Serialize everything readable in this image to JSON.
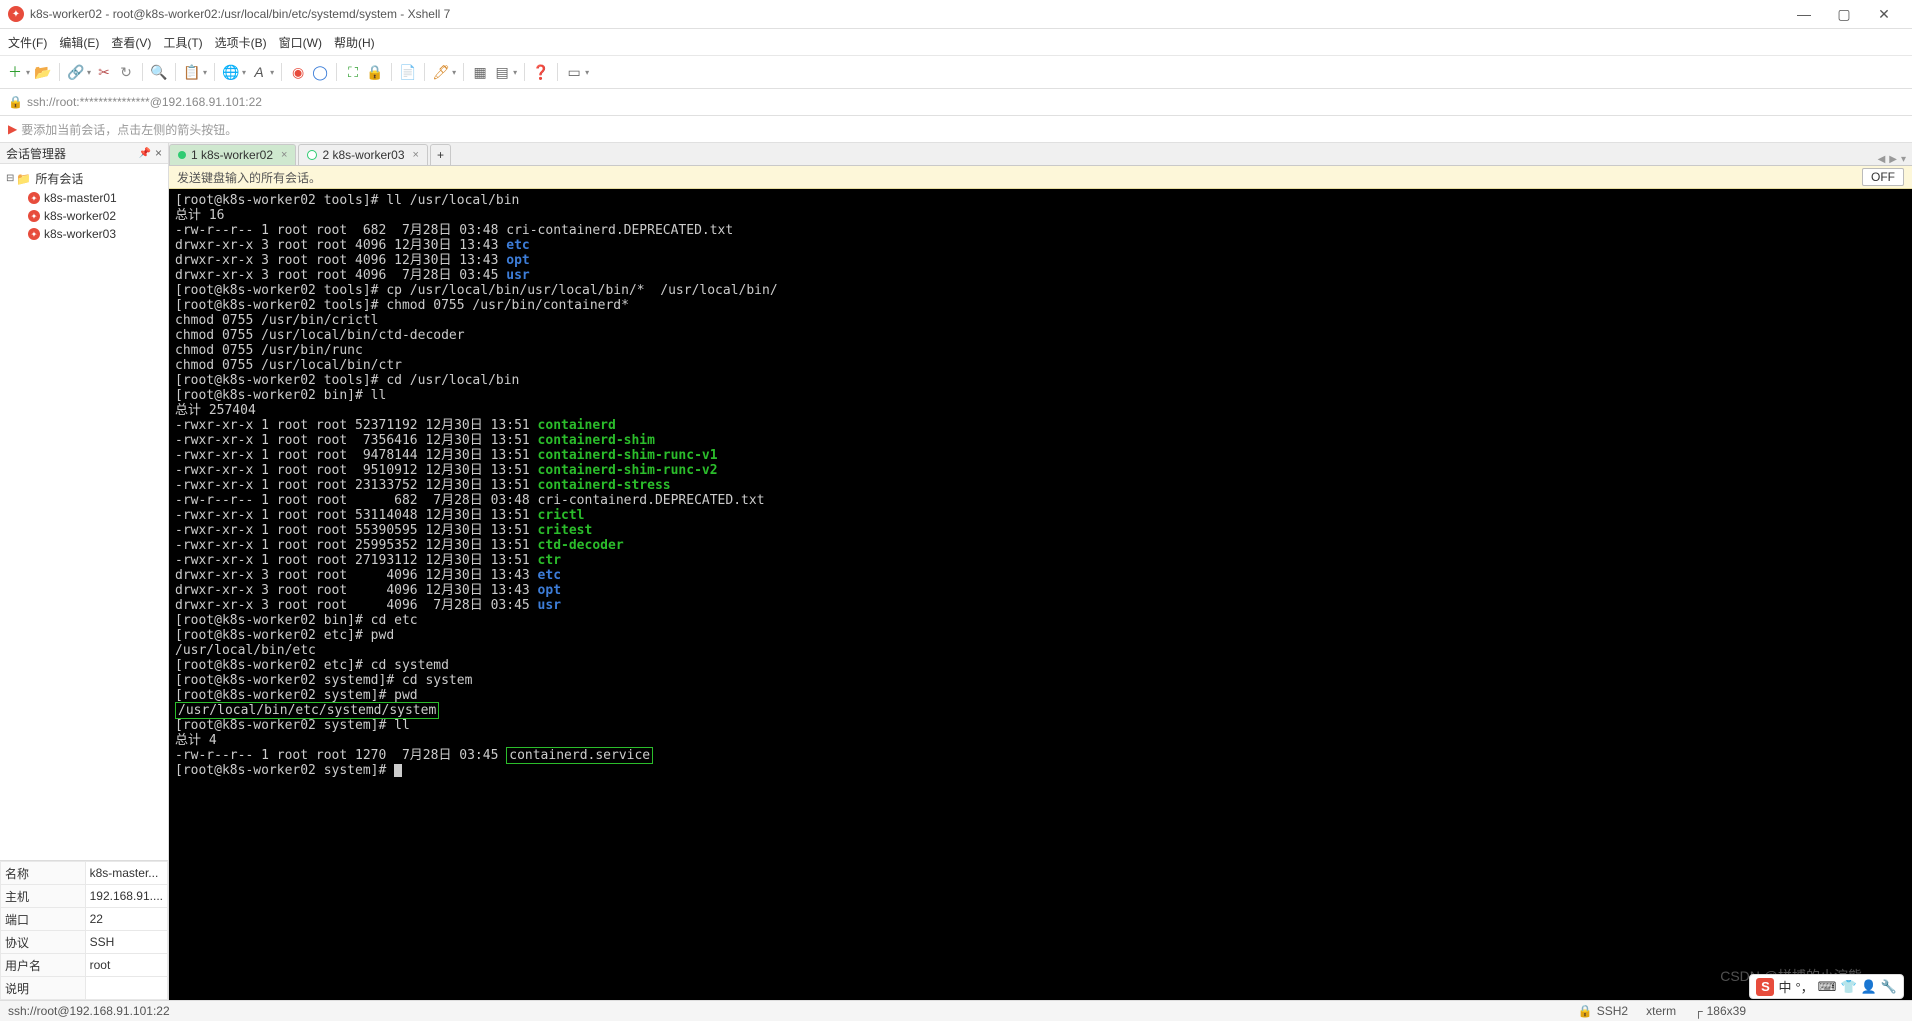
{
  "window": {
    "title": "k8s-worker02 - root@k8s-worker02:/usr/local/bin/etc/systemd/system - Xshell 7"
  },
  "menu": {
    "file": "文件(F)",
    "edit": "编辑(E)",
    "view": "查看(V)",
    "tools": "工具(T)",
    "tabs": "选项卡(B)",
    "window": "窗口(W)",
    "help": "帮助(H)"
  },
  "addressbar": {
    "url": "ssh://root:***************@192.168.91.101:22"
  },
  "hint": {
    "text": "要添加当前会话，点击左侧的箭头按钮。"
  },
  "sidebar": {
    "title": "会话管理器",
    "root": "所有会话",
    "nodes": [
      "k8s-master01",
      "k8s-worker02",
      "k8s-worker03"
    ]
  },
  "props": {
    "labels": {
      "name": "名称",
      "host": "主机",
      "port": "端口",
      "proto": "协议",
      "user": "用户名",
      "desc": "说明"
    },
    "values": {
      "name": "k8s-master...",
      "host": "192.168.91....",
      "port": "22",
      "proto": "SSH",
      "user": "root",
      "desc": ""
    }
  },
  "tabs": {
    "t1": "1 k8s-worker02",
    "t2": "2 k8s-worker03"
  },
  "infobar": {
    "text": "发送键盘输入的所有会话。",
    "off": "OFF"
  },
  "term": {
    "l01": "[root@k8s-worker02 tools]# ll /usr/local/bin",
    "l02": "总计 16",
    "l03a": "-rw-r--r-- 1 root root  682  7月28日 03:48 cri-containerd.DEPRECATED.txt",
    "l04a": "drwxr-xr-x 3 root root 4096 12月30日 13:43 ",
    "l04b": "etc",
    "l05a": "drwxr-xr-x 3 root root 4096 12月30日 13:43 ",
    "l05b": "opt",
    "l06a": "drwxr-xr-x 3 root root 4096  7月28日 03:45 ",
    "l06b": "usr",
    "l07": "[root@k8s-worker02 tools]# cp /usr/local/bin/usr/local/bin/*  /usr/local/bin/",
    "l08": "[root@k8s-worker02 tools]# chmod 0755 /usr/bin/containerd*",
    "l09": "chmod 0755 /usr/bin/crictl",
    "l10": "chmod 0755 /usr/local/bin/ctd-decoder",
    "l11": "chmod 0755 /usr/bin/runc",
    "l12": "chmod 0755 /usr/local/bin/ctr",
    "l13": "[root@k8s-worker02 tools]# cd /usr/local/bin",
    "l14": "[root@k8s-worker02 bin]# ll",
    "l15": "总计 257404",
    "l16a": "-rwxr-xr-x 1 root root 52371192 12月30日 13:51 ",
    "l16b": "containerd",
    "l17a": "-rwxr-xr-x 1 root root  7356416 12月30日 13:51 ",
    "l17b": "containerd-shim",
    "l18a": "-rwxr-xr-x 1 root root  9478144 12月30日 13:51 ",
    "l18b": "containerd-shim-runc-v1",
    "l19a": "-rwxr-xr-x 1 root root  9510912 12月30日 13:51 ",
    "l19b": "containerd-shim-runc-v2",
    "l20a": "-rwxr-xr-x 1 root root 23133752 12月30日 13:51 ",
    "l20b": "containerd-stress",
    "l21": "-rw-r--r-- 1 root root      682  7月28日 03:48 cri-containerd.DEPRECATED.txt",
    "l22a": "-rwxr-xr-x 1 root root 53114048 12月30日 13:51 ",
    "l22b": "crictl",
    "l23a": "-rwxr-xr-x 1 root root 55390595 12月30日 13:51 ",
    "l23b": "critest",
    "l24a": "-rwxr-xr-x 1 root root 25995352 12月30日 13:51 ",
    "l24b": "ctd-decoder",
    "l25a": "-rwxr-xr-x 1 root root 27193112 12月30日 13:51 ",
    "l25b": "ctr",
    "l26a": "drwxr-xr-x 3 root root     4096 12月30日 13:43 ",
    "l26b": "etc",
    "l27a": "drwxr-xr-x 3 root root     4096 12月30日 13:43 ",
    "l27b": "opt",
    "l28a": "drwxr-xr-x 3 root root     4096  7月28日 03:45 ",
    "l28b": "usr",
    "l29": "[root@k8s-worker02 bin]# cd etc",
    "l30": "[root@k8s-worker02 etc]# pwd",
    "l31": "/usr/local/bin/etc",
    "l32": "[root@k8s-worker02 etc]# cd systemd",
    "l33": "[root@k8s-worker02 systemd]# cd system",
    "l34": "[root@k8s-worker02 system]# pwd",
    "l35": "/usr/local/bin/etc/systemd/system",
    "l36": "[root@k8s-worker02 system]# ll",
    "l37": "总计 4",
    "l38a": "-rw-r--r-- 1 root root 1270  7月28日 03:45 ",
    "l38b": "containerd.service",
    "l39": "[root@k8s-worker02 system]# "
  },
  "status": {
    "left": "ssh://root@192.168.91.101:22",
    "ssh": "SSH2",
    "term": "xterm",
    "size": "186x39"
  },
  "ime": {
    "mode": "中"
  }
}
